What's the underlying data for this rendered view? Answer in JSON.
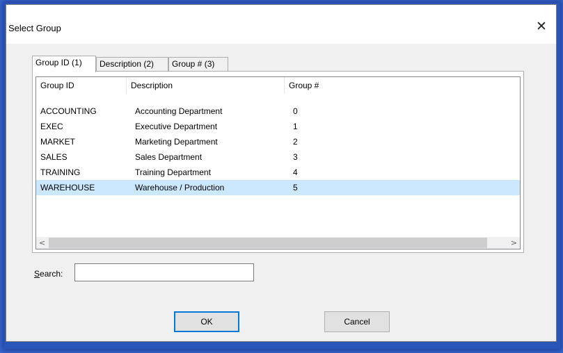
{
  "dialog": {
    "title": "Select Group",
    "close_symbol": "✕"
  },
  "tabs": [
    {
      "label": "Group ID (1)",
      "active": true
    },
    {
      "label": "Description (2)",
      "active": false
    },
    {
      "label": "Group # (3)",
      "active": false
    }
  ],
  "list": {
    "columns": [
      "Group ID",
      "Description",
      "Group #"
    ],
    "rows": [
      {
        "group_id": "ACCOUNTING",
        "description": "Accounting Department",
        "group_num": "0",
        "selected": false
      },
      {
        "group_id": "EXEC",
        "description": "Executive Department",
        "group_num": "1",
        "selected": false
      },
      {
        "group_id": "MARKET",
        "description": "Marketing Department",
        "group_num": "2",
        "selected": false
      },
      {
        "group_id": "SALES",
        "description": "Sales Department",
        "group_num": "3",
        "selected": false
      },
      {
        "group_id": "TRAINING",
        "description": "Training Department",
        "group_num": "4",
        "selected": false
      },
      {
        "group_id": "WAREHOUSE",
        "description": "Warehouse / Production",
        "group_num": "5",
        "selected": true
      }
    ],
    "scroll_left_symbol": "<",
    "scroll_right_symbol": ">"
  },
  "search": {
    "label_accel": "S",
    "label_rest": "earch:",
    "value": "",
    "placeholder": ""
  },
  "buttons": {
    "ok_label": "OK",
    "cancel_label": "Cancel"
  },
  "colors": {
    "selection": "#cce8ff",
    "default_button_border": "#0078d7",
    "window_background": "#f0f0f0"
  },
  "icons": {
    "close": "close-icon",
    "scroll_left": "chevron-left-icon",
    "scroll_right": "chevron-right-icon"
  }
}
